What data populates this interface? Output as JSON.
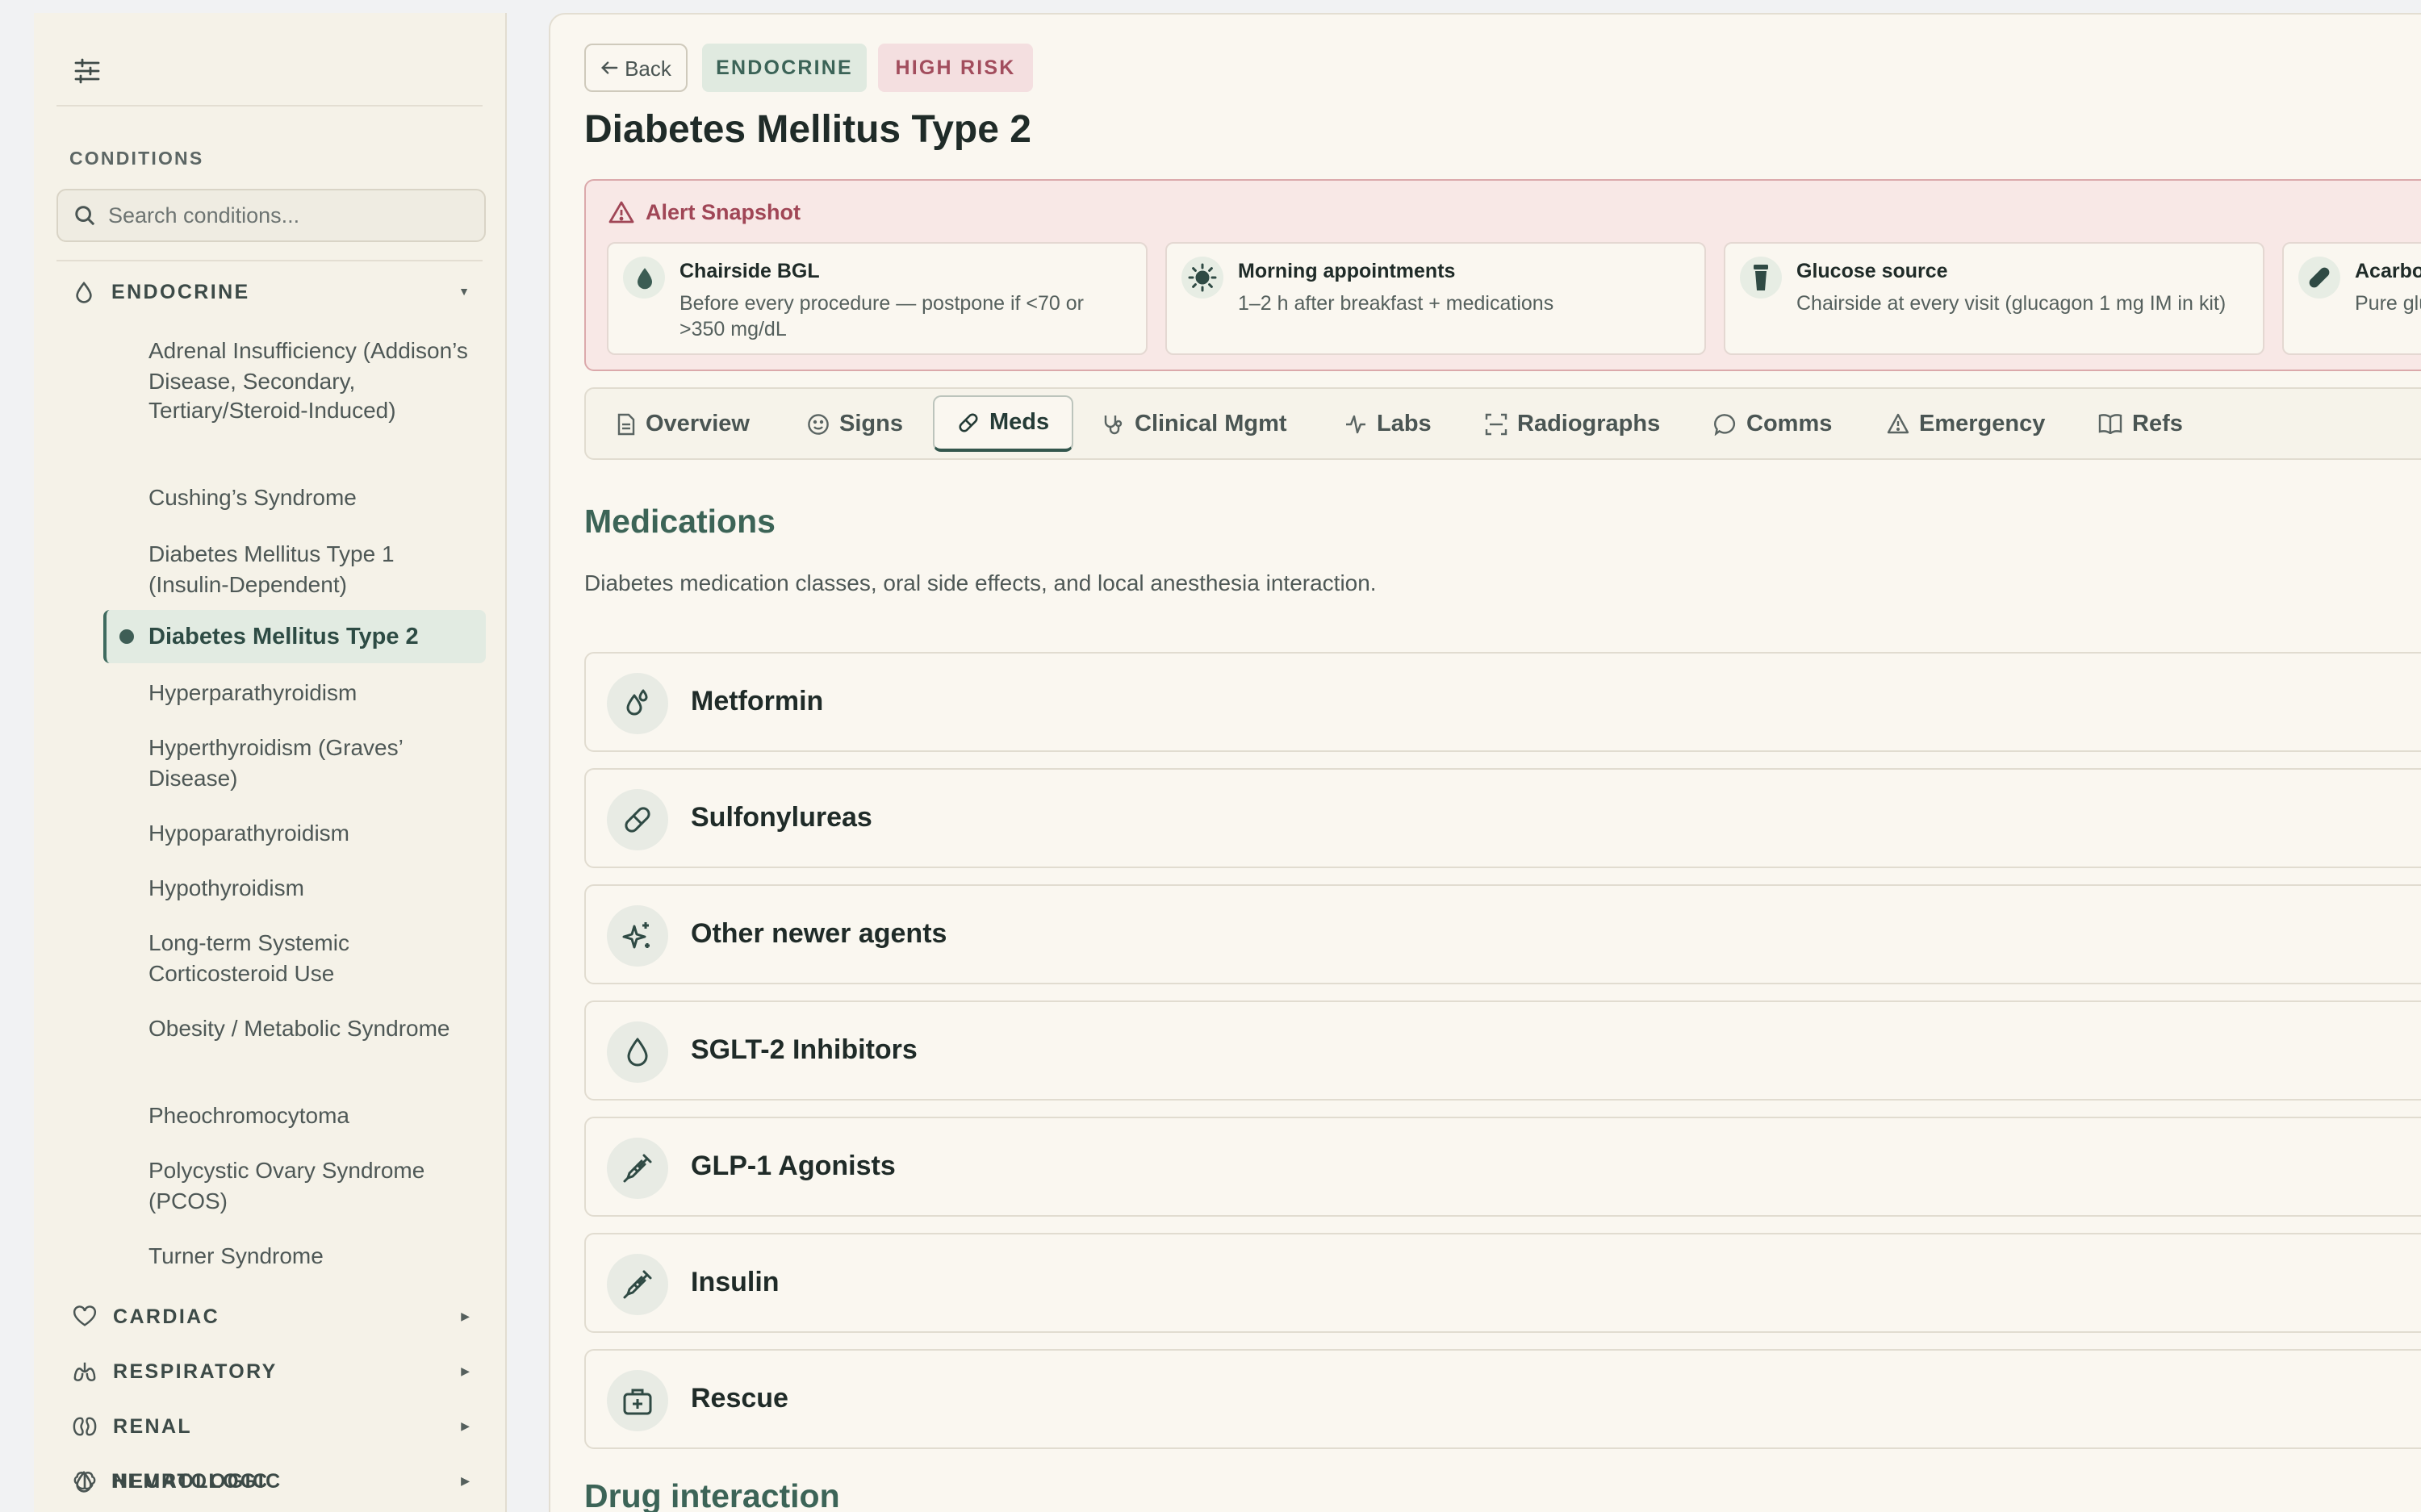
{
  "sidebar": {
    "section_title": "CONDITIONS",
    "search_placeholder": "Search conditions...",
    "categories": [
      {
        "label": "ENDOCRINE",
        "icon": "drop-icon",
        "expanded": true
      },
      {
        "label": "CARDIAC",
        "icon": "heart-icon",
        "expanded": false
      },
      {
        "label": "RESPIRATORY",
        "icon": "lungs-icon",
        "expanded": false
      },
      {
        "label": "RENAL",
        "icon": "kidneys-icon",
        "expanded": false
      },
      {
        "label": "HEMATOLOGIC",
        "icon": "drop-icon",
        "expanded": false
      },
      {
        "label": "NEUROLOGIC",
        "icon": "brain-icon",
        "expanded": false
      }
    ],
    "endocrine_items": [
      "Adrenal Insufficiency (Addison’s Disease, Secondary, Tertiary/Steroid-Induced)",
      "Cushing’s Syndrome",
      "Diabetes Mellitus Type 1 (Insulin-Dependent)",
      "Diabetes Mellitus Type 2",
      "Hyperparathyroidism",
      "Hyperthyroidism (Graves’ Disease)",
      "Hypoparathyroidism",
      "Hypothyroidism",
      "Long-term Systemic Corticosteroid Use",
      "Obesity / Metabolic Syndrome",
      "Pheochromocytoma",
      "Polycystic Ovary Syndrome (PCOS)",
      "Turner Syndrome"
    ],
    "active_item": "Diabetes Mellitus Type 2"
  },
  "header": {
    "back_label": "Back",
    "category_badge": "ENDOCRINE",
    "risk_badge": "HIGH RISK",
    "title": "Diabetes Mellitus Type 2"
  },
  "alert": {
    "title": "Alert Snapshot",
    "cards": [
      {
        "title": "Chairside BGL",
        "desc": "Before every procedure — postpone if <70 or >350 mg/dL",
        "icon": "drop-icon"
      },
      {
        "title": "Morning appointments",
        "desc": "1–2 h after breakfast + medications",
        "icon": "sun-icon"
      },
      {
        "title": "Glucose source",
        "desc": "Chairside at every visit (glucagon 1 mg IM in kit)",
        "icon": "cup-icon"
      },
      {
        "title": "Acarbose / miglito",
        "desc": "Pure glucose table not work",
        "icon": "pill-icon"
      }
    ]
  },
  "tabs": [
    {
      "label": "Overview",
      "icon": "document-icon"
    },
    {
      "label": "Signs",
      "icon": "face-icon"
    },
    {
      "label": "Meds",
      "icon": "pill-icon",
      "active": true
    },
    {
      "label": "Clinical Mgmt",
      "icon": "stethoscope-icon"
    },
    {
      "label": "Labs",
      "icon": "pulse-icon"
    },
    {
      "label": "Radiographs",
      "icon": "scan-icon"
    },
    {
      "label": "Comms",
      "icon": "chat-icon"
    },
    {
      "label": "Emergency",
      "icon": "warning-icon"
    },
    {
      "label": "Refs",
      "icon": "book-icon"
    }
  ],
  "medications": {
    "title": "Medications",
    "description": "Diabetes medication classes, oral side effects, and local anesthesia interaction.",
    "items": [
      {
        "label": "Metformin",
        "icon": "drops-icon"
      },
      {
        "label": "Sulfonylureas",
        "icon": "pill-icon"
      },
      {
        "label": "Other newer agents",
        "icon": "sparkles-icon"
      },
      {
        "label": "SGLT-2 Inhibitors",
        "icon": "drop-icon"
      },
      {
        "label": "GLP-1 Agonists",
        "icon": "syringe-icon"
      },
      {
        "label": "Insulin",
        "icon": "syringe-icon"
      },
      {
        "label": "Rescue",
        "icon": "medkit-icon"
      }
    ]
  },
  "drug_interaction": {
    "title": "Drug interaction"
  },
  "colors": {
    "accent": "#3c6457",
    "risk": "#a24d5d",
    "alert_bg": "#f8e8e6",
    "panel_bg": "#faf7f0",
    "sidebar_bg": "#f5f2e8"
  }
}
